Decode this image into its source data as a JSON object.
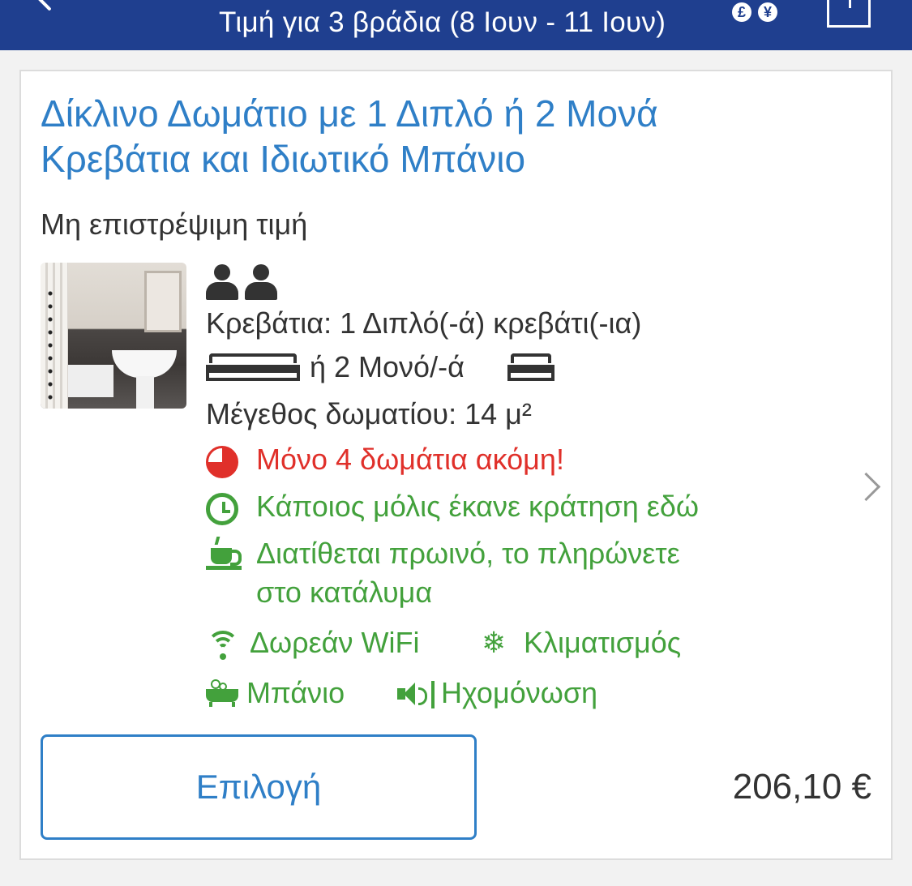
{
  "header": {
    "title": "Τιμή για 3 βράδια (8 Ιουν - 11 Ιουν)",
    "currency_symbols": [
      "£",
      "¥"
    ]
  },
  "room": {
    "title": "Δίκλινο Δωμάτιο με 1 Διπλό ή 2 Μονά Κρεβάτια και Ιδιωτικό Μπάνιο",
    "refund_policy": "Μη επιστρέψιμη τιμή",
    "beds_text": "Κρεβάτια: 1 Διπλό(-ά) κρεβάτι(-ια)",
    "beds_or_text": "ή 2 Μονό/-ά",
    "size_text": "Μέγεθος δωματίου: 14 μ²",
    "scarcity_text": "Μόνο 4 δωμάτια ακόμη!",
    "recent_booking_text": "Κάποιος μόλις έκανε κράτηση εδώ",
    "breakfast_line1": "Διατίθεται πρωινό, το πληρώνετε",
    "breakfast_line2": "στο κατάλυμα",
    "amenities": {
      "wifi": "Δωρεάν WiFi",
      "ac": "Κλιματισμός",
      "bath": "Μπάνιο",
      "soundproof": "Ηχομόνωση"
    },
    "select_label": "Επιλογή",
    "price": "206,10 €"
  },
  "colors": {
    "header_bg": "#1f3f8f",
    "title_blue": "#2f7fc7",
    "alert_red": "#e0302a",
    "feature_green": "#43a13c"
  },
  "icons": [
    "back-arrow-icon",
    "currency-icon",
    "share-icon",
    "guests-icon",
    "double-bed-icon",
    "single-bed-icon",
    "scarcity-pie-icon",
    "alarm-clock-icon",
    "coffee-cup-icon",
    "wifi-icon",
    "snowflake-icon",
    "bathtub-icon",
    "speaker-icon",
    "chevron-right-icon"
  ]
}
